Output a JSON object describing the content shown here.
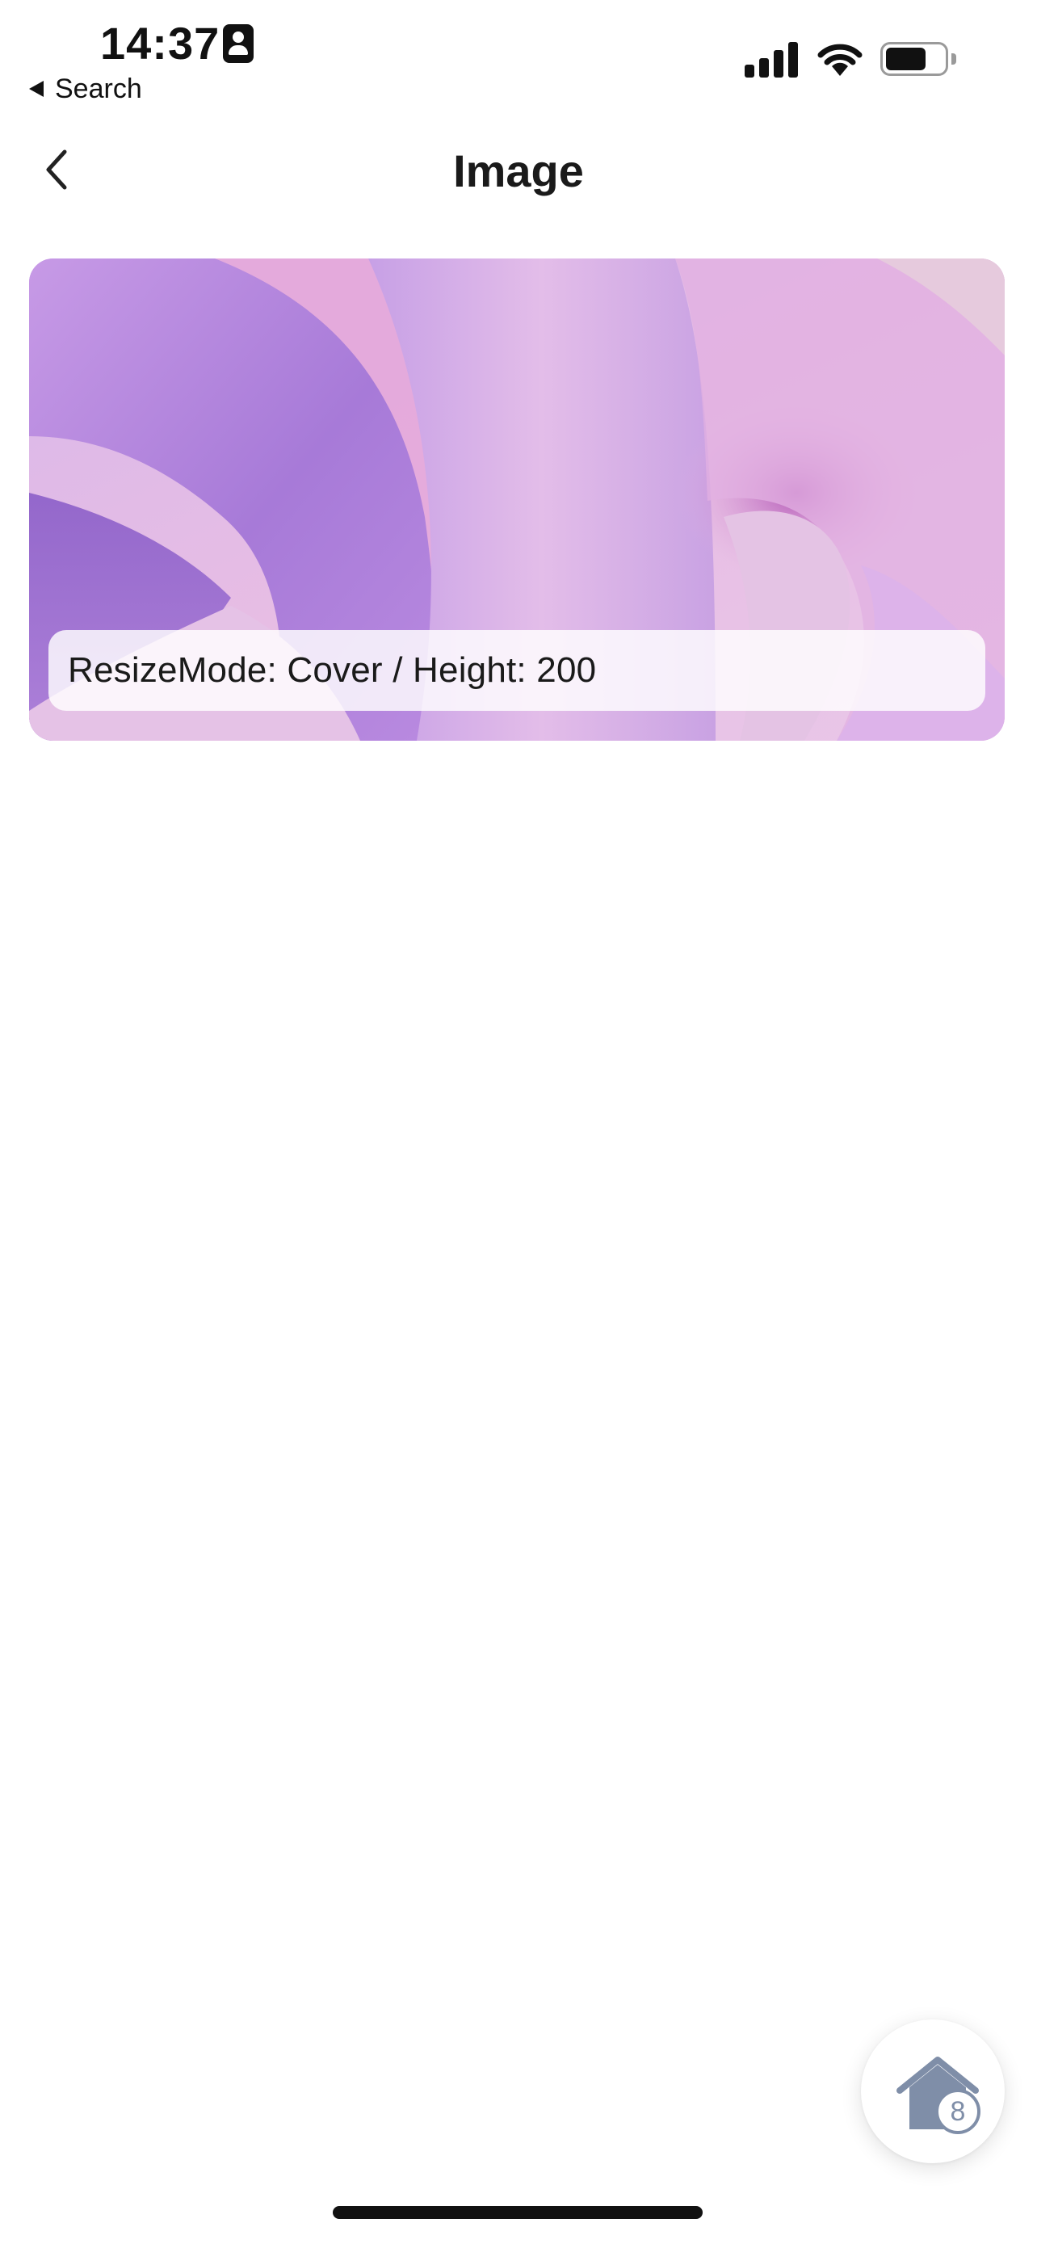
{
  "status_bar": {
    "time": "14:37",
    "back_app_label": "Search",
    "signal_bars": 4,
    "battery_level": 0.7
  },
  "header": {
    "title": "Image"
  },
  "image_card": {
    "caption": "ResizeMode: Cover / Height: 200"
  },
  "floating_button": {
    "icon": "home-icon",
    "count": "8"
  },
  "colors": {
    "image_base": "#d9b5e6",
    "fab_icon": "#7f8ea8"
  }
}
